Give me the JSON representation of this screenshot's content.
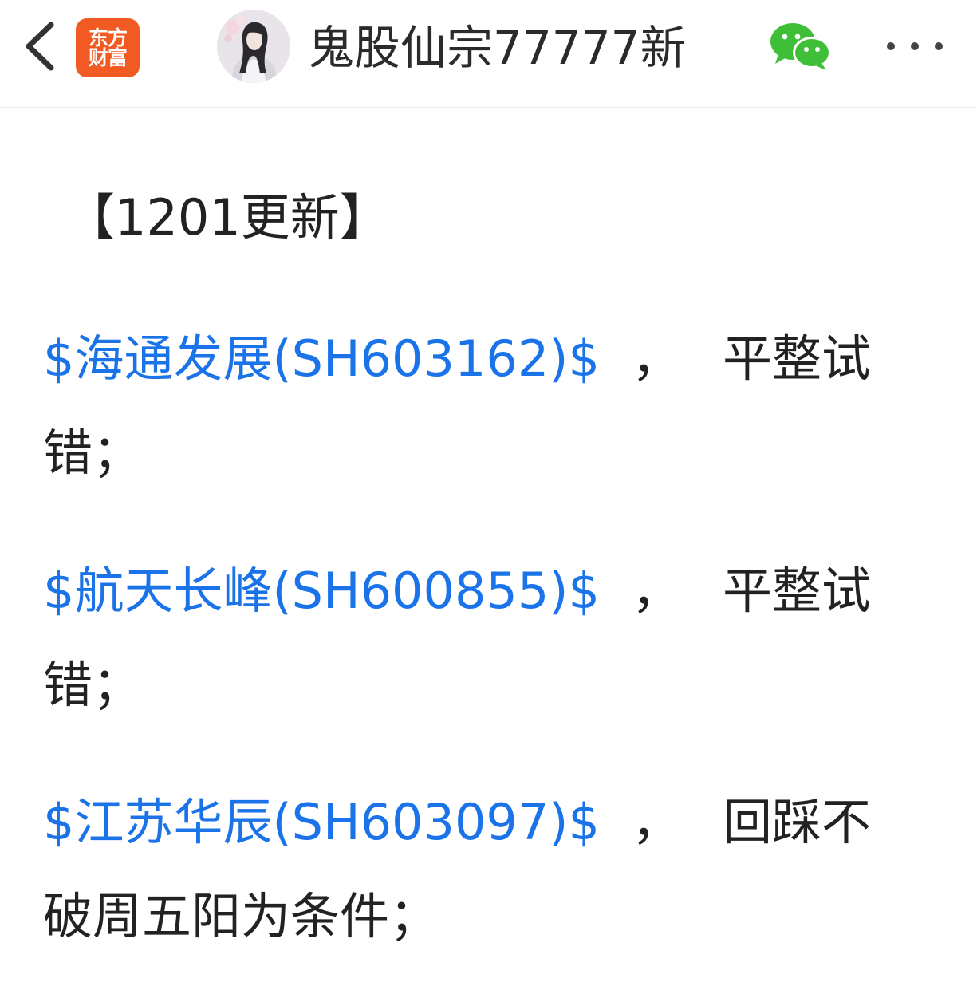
{
  "header": {
    "app_logo_line1": "东方",
    "app_logo_line2": "财富",
    "author_name": "鬼股仙宗77777新",
    "icons": {
      "back": "chevron-left-icon",
      "wechat": "wechat-icon",
      "more": "more-dots-icon"
    },
    "colors": {
      "logo_bg": "#f15a22",
      "wechat": "#3fbf37"
    }
  },
  "post": {
    "title": "【1201更新】",
    "items": [
      {
        "stock": "$海通发展(SH603162)$",
        "comma": "，",
        "note_line1": "平整试",
        "note_line2": "错；"
      },
      {
        "stock": "$航天长峰(SH600855)$",
        "comma": "，",
        "note_line1": "平整试",
        "note_line2": "错；"
      },
      {
        "stock": "$江苏华辰(SH603097)$",
        "comma": "，",
        "note_line1": "回踩不",
        "note_line2": "破周五阳为条件；"
      }
    ],
    "colors": {
      "link": "#1a73e8",
      "text": "#222222"
    }
  }
}
